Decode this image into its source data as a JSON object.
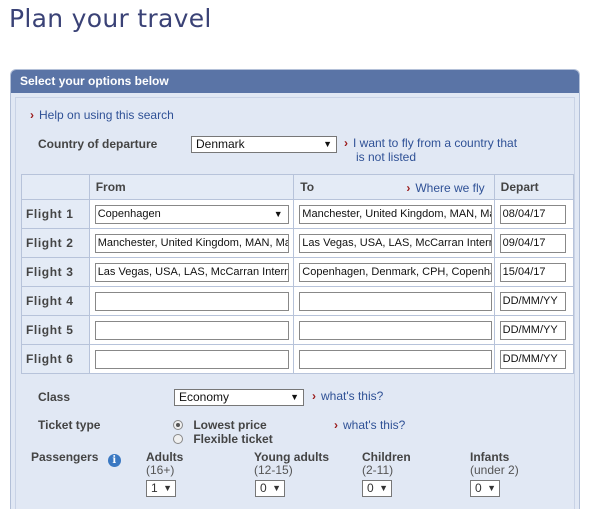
{
  "page": {
    "title": "Plan your travel"
  },
  "panel": {
    "header": "Select your options below"
  },
  "help_link": "Help on using this search",
  "departure": {
    "label": "Country of departure",
    "value": "Denmark",
    "other_country_line1": "I want to fly from a country that",
    "other_country_line2": "is not listed"
  },
  "table": {
    "col_from": "From",
    "col_to": "To",
    "where_we_fly": "Where we fly",
    "col_depart": "Depart",
    "flights": [
      {
        "label": "Flight  1",
        "from": "Copenhagen",
        "to": "Manchester, United Kingdom, MAN, Ma",
        "depart": "08/04/17"
      },
      {
        "label": "Flight  2",
        "from": "Manchester, United Kingdom, MAN, Ma",
        "to": "Las Vegas, USA, LAS, McCarran Intern",
        "depart": "09/04/17"
      },
      {
        "label": "Flight  3",
        "from": "Las Vegas, USA, LAS, McCarran Intern",
        "to": "Copenhagen, Denmark, CPH, Copenha",
        "depart": "15/04/17"
      },
      {
        "label": "Flight  4",
        "from": "",
        "to": "",
        "depart": "DD/MM/YY"
      },
      {
        "label": "Flight  5",
        "from": "",
        "to": "",
        "depart": "DD/MM/YY"
      },
      {
        "label": "Flight  6",
        "from": "",
        "to": "",
        "depart": "DD/MM/YY"
      }
    ]
  },
  "class": {
    "label": "Class",
    "value": "Economy",
    "whats_this": "what's this?"
  },
  "ticket": {
    "label": "Ticket type",
    "option1": "Lowest price",
    "option2": "Flexible  ticket",
    "whats_this": "what's this?"
  },
  "passengers": {
    "label": "Passengers",
    "info_icon": "i",
    "adults": {
      "label": "Adults",
      "sub": "(16+)",
      "value": "1"
    },
    "young_adults": {
      "label": "Young adults",
      "sub": "(12-15)",
      "value": "0"
    },
    "children": {
      "label": "Children",
      "sub": "(2-11)",
      "value": "0"
    },
    "infants": {
      "label": "Infants",
      "sub": "(under 2)",
      "value": "0"
    }
  }
}
